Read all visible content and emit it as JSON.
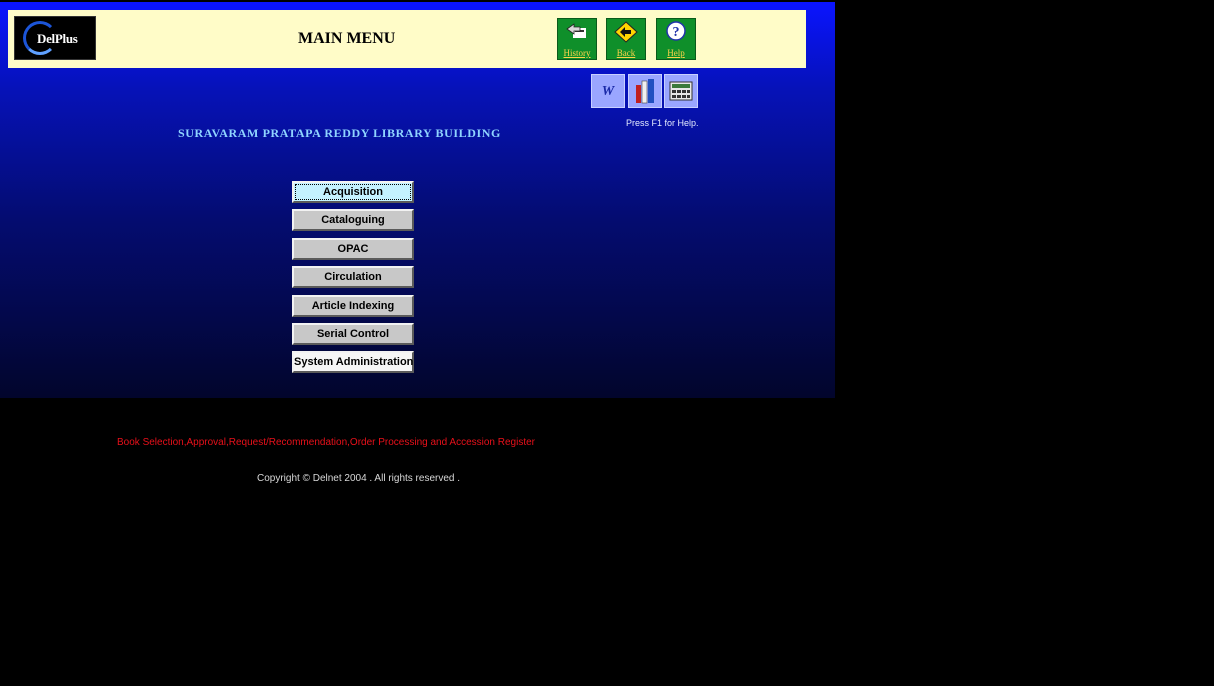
{
  "header": {
    "logo_text": "DelPlus",
    "title": "MAIN MENU",
    "toolbar": {
      "history_label": "History",
      "back_label": "Back",
      "help_label": "Help"
    }
  },
  "tools": {
    "word_icon": "W",
    "help_text": "Press F1 for Help."
  },
  "library_name": "SURAVARAM PRATAPA REDDY LIBRARY BUILDING",
  "menu": {
    "items": [
      {
        "label": "Acquisition",
        "state": "focused"
      },
      {
        "label": "Cataloguing"
      },
      {
        "label": "OPAC"
      },
      {
        "label": "Circulation"
      },
      {
        "label": "Article Indexing"
      },
      {
        "label": "Serial Control"
      },
      {
        "label": "System Administration"
      }
    ]
  },
  "status_text": "Book Selection,Approval,Request/Recommendation,Order Processing and Accession Register",
  "copyright": "Copyright © Delnet 2004 . All rights reserved .",
  "colors": {
    "header_bg": "#fffcc8",
    "toolbar_button": "#0f8f2a",
    "status_text": "#e8101a",
    "library_name": "#8fd4ff"
  }
}
